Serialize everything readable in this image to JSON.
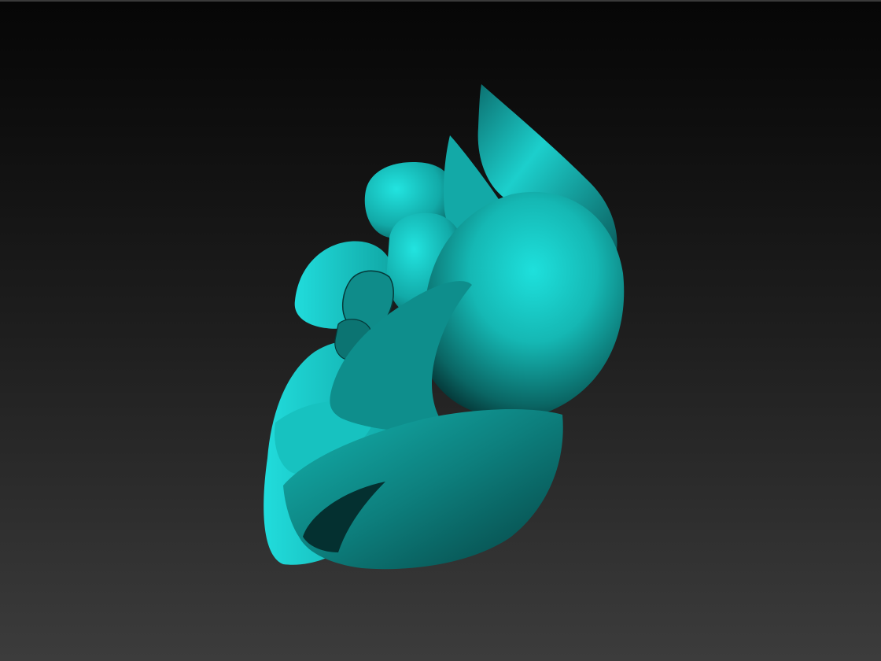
{
  "viewport": {
    "background_top": "#060606",
    "background_bottom": "#3c3c3c"
  },
  "model": {
    "name_icon": "flower-sculpt-mesh",
    "material_color": "#1fd4d4",
    "highlight_color": "#2ee6e6",
    "shadow_color": "#0a4444"
  }
}
